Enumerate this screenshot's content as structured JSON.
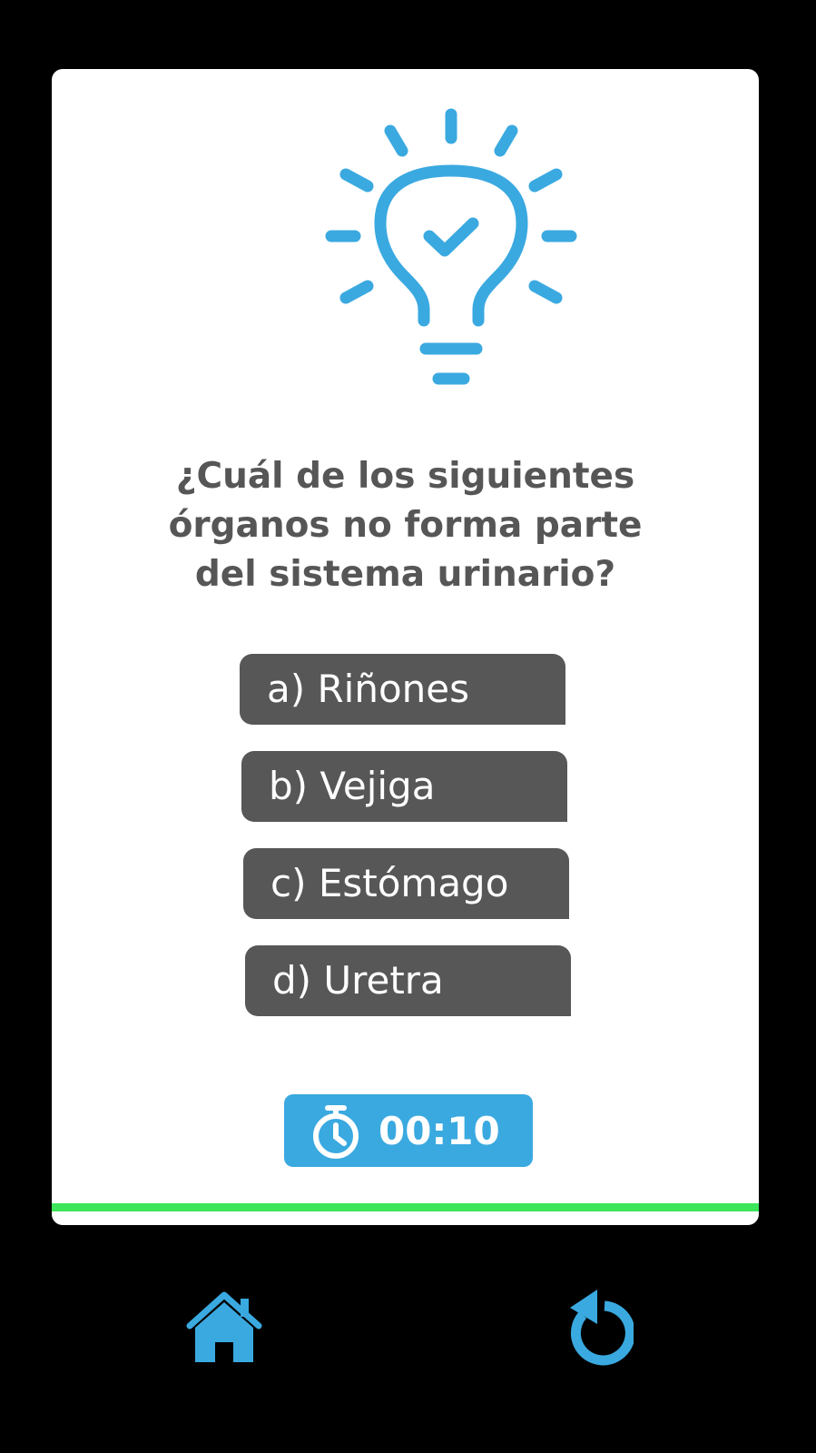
{
  "colors": {
    "accent": "#3aa9e0",
    "option_bg": "#575757",
    "question_text": "#565656",
    "progress": "#3ce65a"
  },
  "header": {
    "icon": "lightbulb-check-icon"
  },
  "question": {
    "lines": [
      "¿Cuál de los siguientes",
      "órganos no forma parte",
      "del sistema urinario?"
    ]
  },
  "options": [
    {
      "label": "a) Riñones"
    },
    {
      "label": "b) Vejiga"
    },
    {
      "label": "c) Estómago"
    },
    {
      "label": "d) Uretra"
    }
  ],
  "timer": {
    "icon": "stopwatch-icon",
    "value": "00:10"
  },
  "progress": {
    "fraction": 1.0
  },
  "nav": {
    "home_icon": "home-icon",
    "restart_icon": "restart-icon"
  }
}
